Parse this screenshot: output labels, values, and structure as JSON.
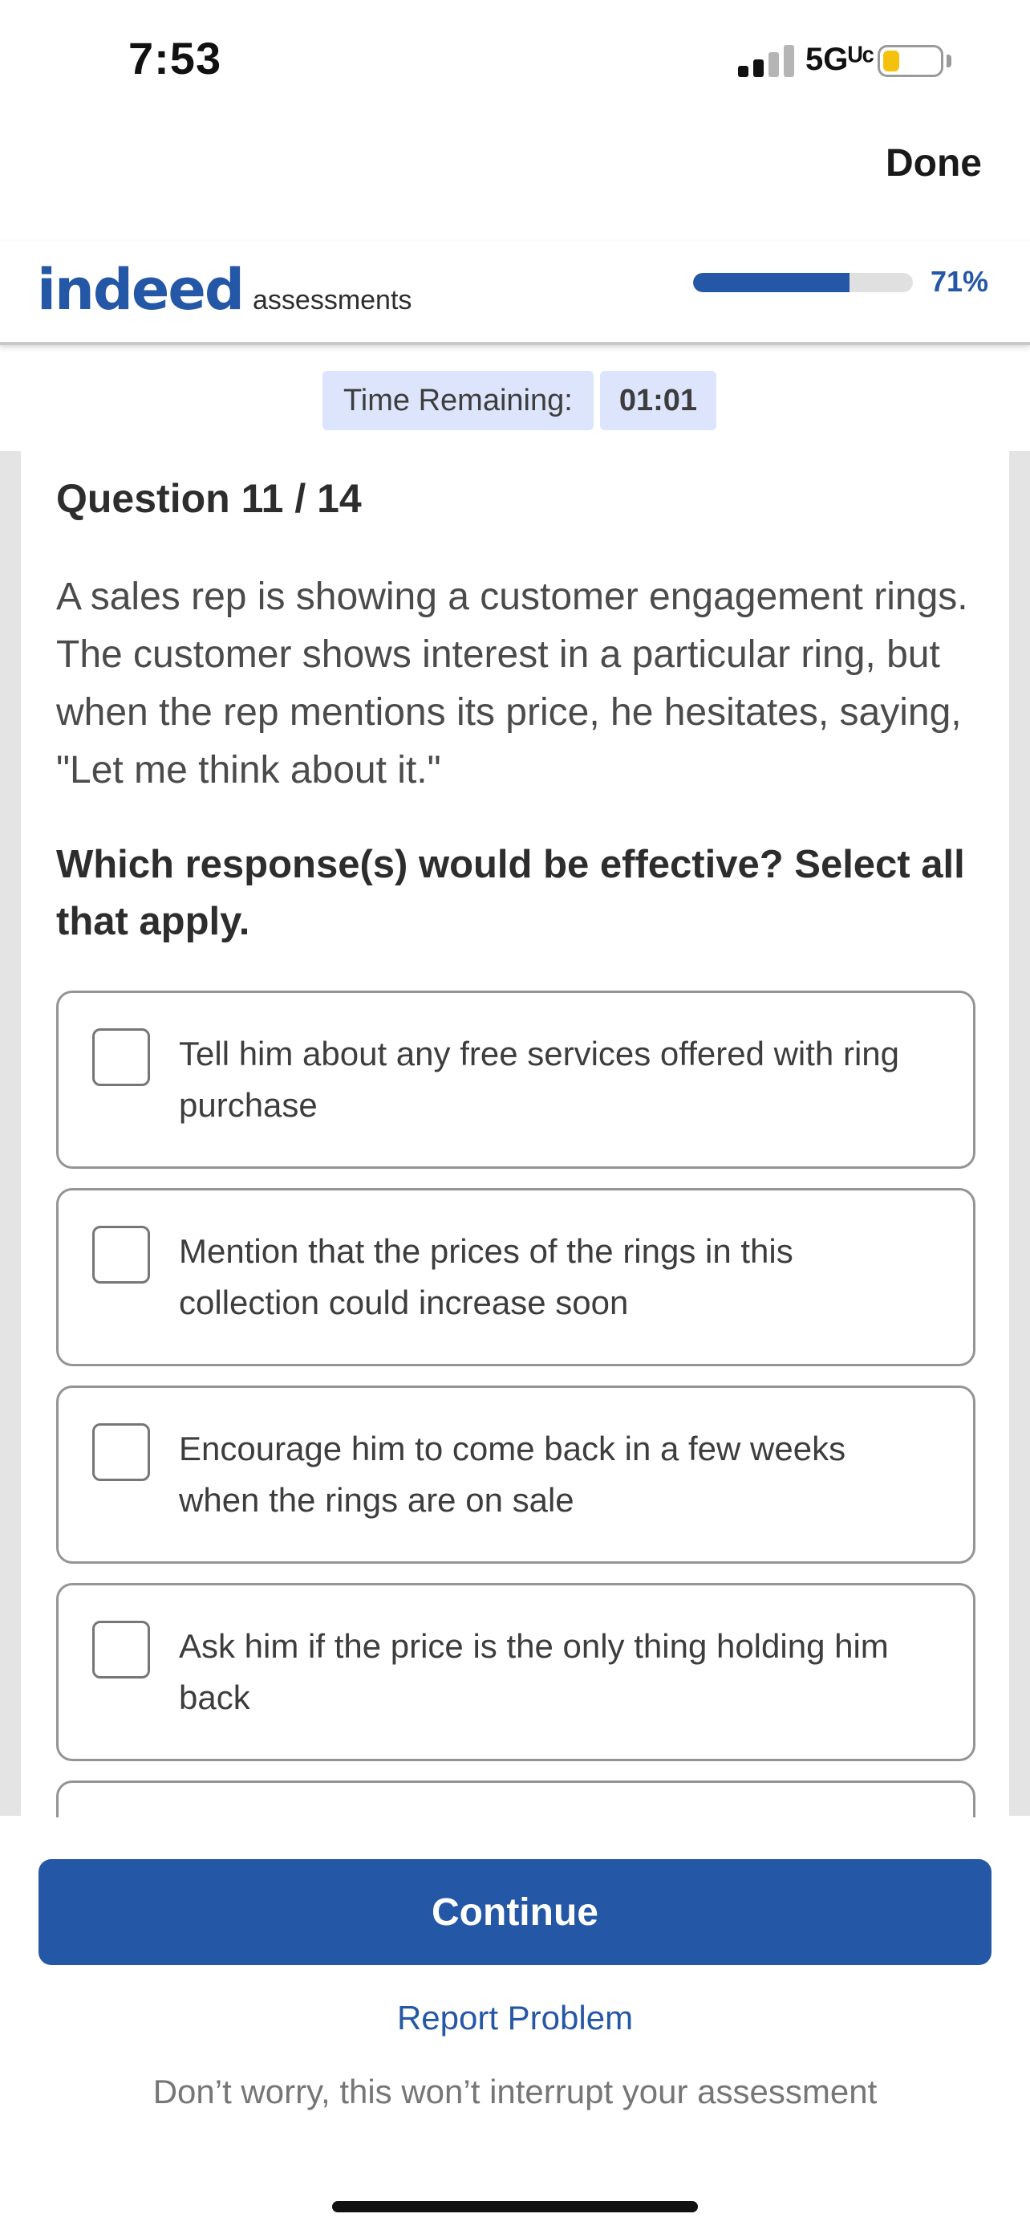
{
  "status_bar": {
    "time": "7:53",
    "network": "5Gᵁᶜ",
    "battery_level": 0.3,
    "battery_color": "#f4c20d"
  },
  "nav": {
    "done_label": "Done"
  },
  "header": {
    "logo_word": "indeed",
    "logo_sub": "assessments",
    "progress_percent": 71,
    "progress_label": "71%",
    "accent_color": "#2557a7"
  },
  "timer": {
    "label": "Time Remaining:",
    "value": "01:01"
  },
  "question": {
    "number": "Question 11 / 14",
    "text": "A sales rep is showing a customer engagement rings. The customer shows interest in a particular ring, but when the rep mentions its price, he hesitates, saying, \"Let me think about it.\"",
    "instruction": "Which response(s) would be effective? Select all that apply.",
    "options": [
      {
        "label": "Tell him about any free services offered with ring purchase",
        "checked": false
      },
      {
        "label": "Mention that the prices of the rings in this collection could increase soon",
        "checked": false
      },
      {
        "label": "Encourage him to come back in a few weeks when the rings are on sale",
        "checked": false
      },
      {
        "label": "Ask him if the price is the only thing holding him back",
        "checked": false
      }
    ]
  },
  "footer": {
    "continue_label": "Continue",
    "report_label": "Report Problem",
    "note": "Don’t worry, this won’t interrupt your assessment"
  }
}
